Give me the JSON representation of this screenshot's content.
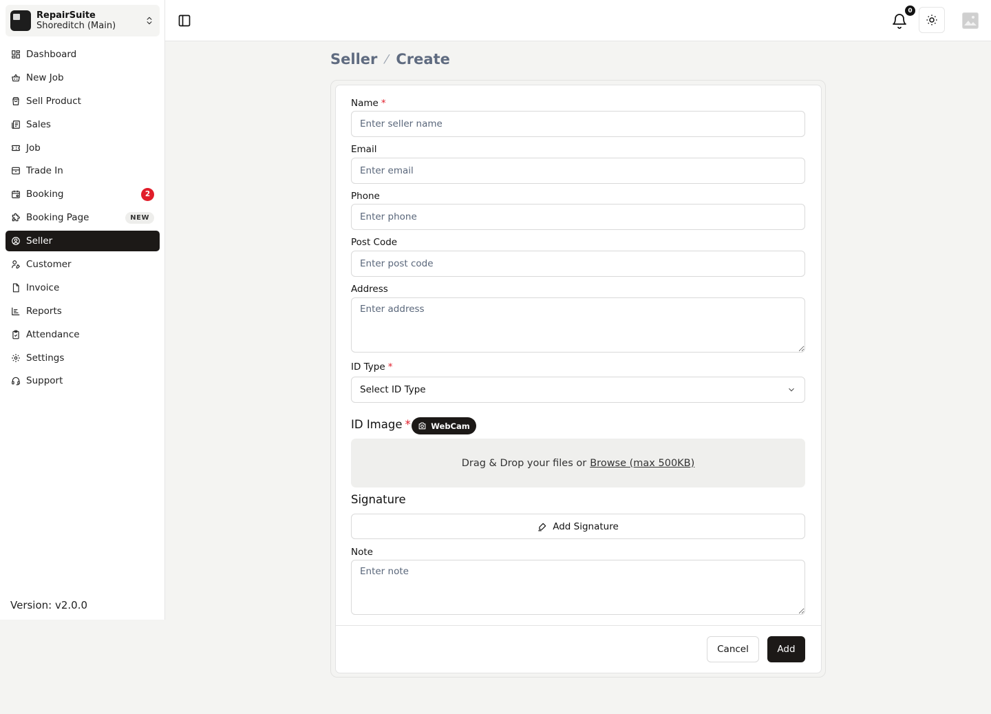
{
  "brand": {
    "name": "RepairSuite",
    "location": "Shoreditch (Main)"
  },
  "nav": [
    {
      "label": "Dashboard",
      "icon": "dashboard-icon"
    },
    {
      "label": "New Job",
      "icon": "basket-icon"
    },
    {
      "label": "Sell Product",
      "icon": "shopping-bag-icon"
    },
    {
      "label": "Sales",
      "icon": "sales-icon"
    },
    {
      "label": "Job",
      "icon": "ticket-icon"
    },
    {
      "label": "Trade In",
      "icon": "archive-icon"
    },
    {
      "label": "Booking",
      "icon": "calendar-icon",
      "badge": "2"
    },
    {
      "label": "Booking Page",
      "icon": "puzzle-icon",
      "badge": "NEW"
    },
    {
      "label": "Seller",
      "icon": "user-circle-icon",
      "active": true
    },
    {
      "label": "Customer",
      "icon": "user-pen-icon"
    },
    {
      "label": "Invoice",
      "icon": "file-icon"
    },
    {
      "label": "Reports",
      "icon": "report-icon"
    },
    {
      "label": "Attendance",
      "icon": "clipboard-check-icon"
    },
    {
      "label": "Settings",
      "icon": "gear-icon"
    },
    {
      "label": "Support",
      "icon": "headset-icon"
    }
  ],
  "version": "Version: v2.0.0",
  "topbar": {
    "notification_count": "0"
  },
  "breadcrumb": {
    "parent": "Seller",
    "current": "Create"
  },
  "form": {
    "name": {
      "label": "Name",
      "placeholder": "Enter seller name"
    },
    "email": {
      "label": "Email",
      "placeholder": "Enter email"
    },
    "phone": {
      "label": "Phone",
      "placeholder": "Enter phone"
    },
    "post_code": {
      "label": "Post Code",
      "placeholder": "Enter post code"
    },
    "address": {
      "label": "Address",
      "placeholder": "Enter address"
    },
    "id_type": {
      "label": "ID Type",
      "value": "Select ID Type"
    },
    "id_image": {
      "label": "ID Image",
      "webcam_label": "WebCam",
      "drop_text": "Drag & Drop your files or",
      "browse_text": "Browse (max 500KB)"
    },
    "signature": {
      "label": "Signature",
      "button_label": "Add Signature"
    },
    "note": {
      "label": "Note",
      "placeholder": "Enter note"
    },
    "required_mark": "*"
  },
  "actions": {
    "cancel_label": "Cancel",
    "add_label": "Add"
  },
  "colors": {
    "primary": "#1c1917",
    "danger": "#e11d2a",
    "breadcrumb": "#5f6b80",
    "background": "#f4f4f2"
  }
}
